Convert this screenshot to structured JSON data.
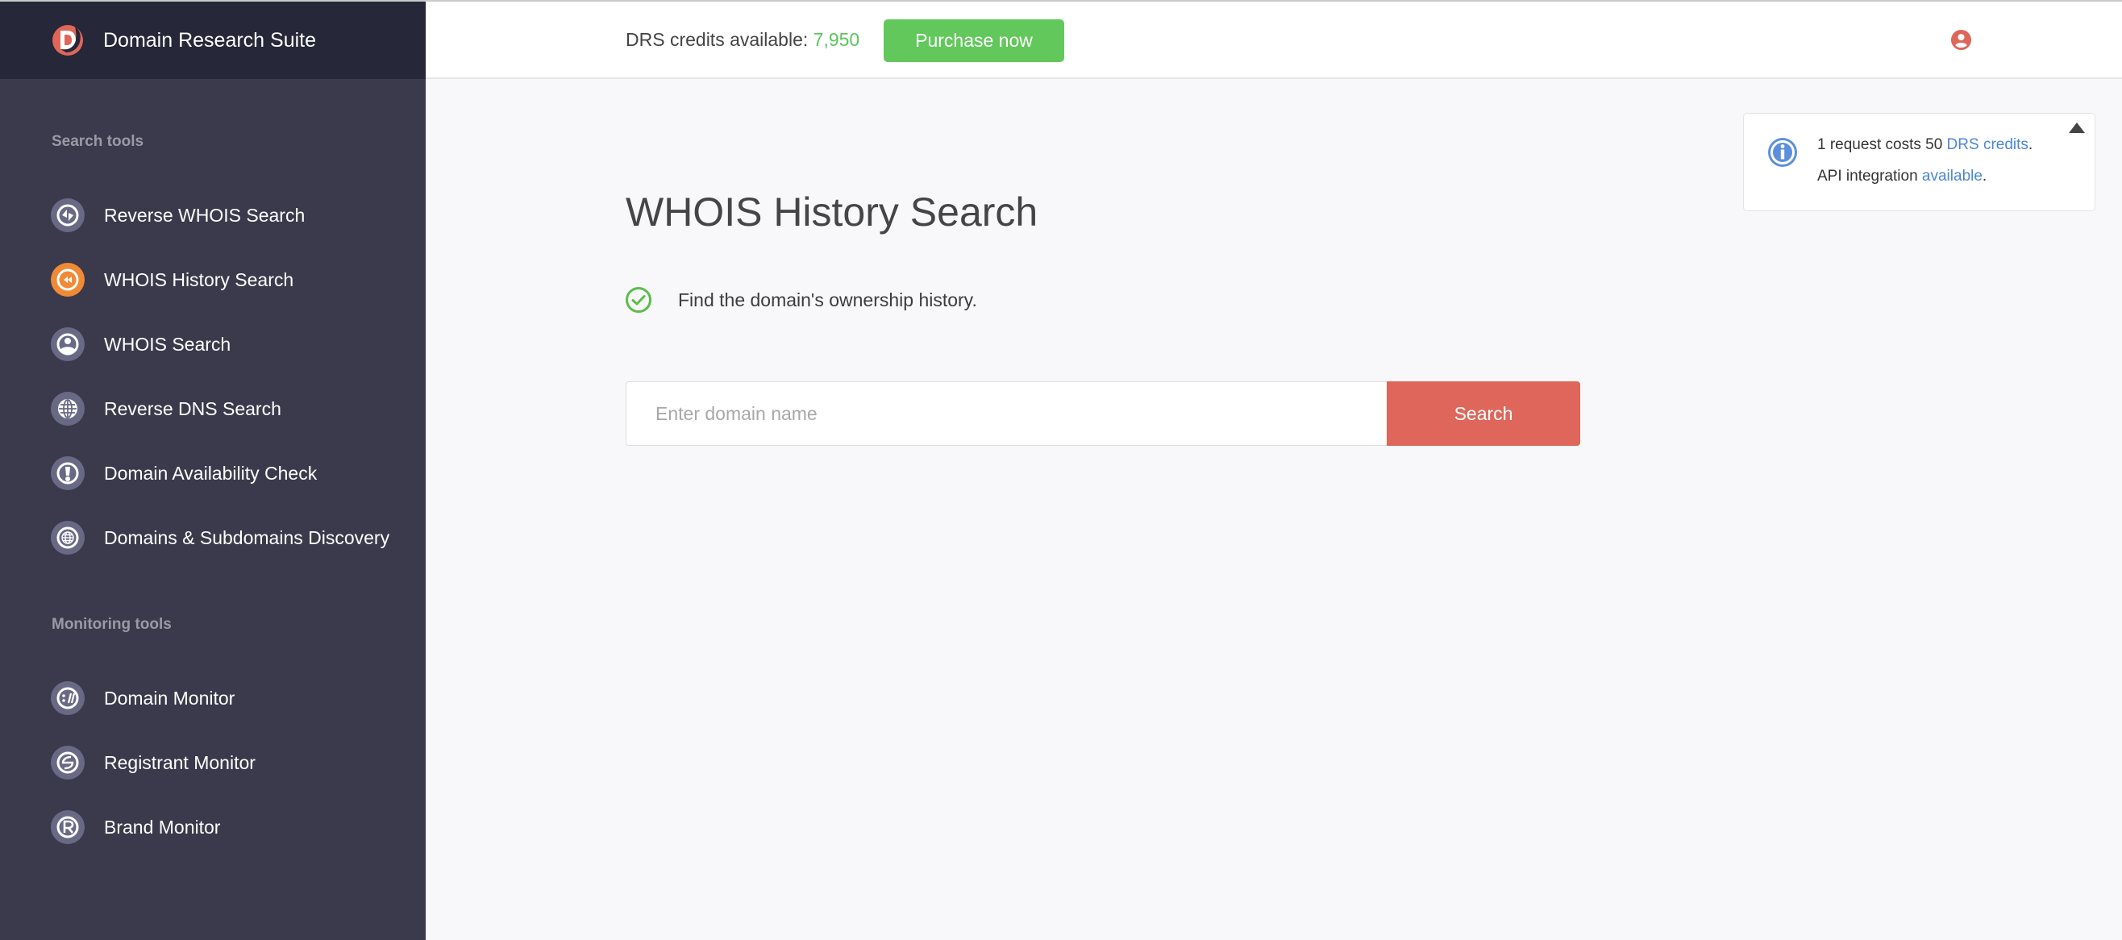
{
  "app": {
    "name": "Domain Research Suite",
    "logo_icon": "drs-logo-icon"
  },
  "sidebar": {
    "sections": [
      {
        "label": "Search tools",
        "items": [
          {
            "label": "Reverse WHOIS Search",
            "icon": "reverse-whois-icon",
            "active": false
          },
          {
            "label": "WHOIS History Search",
            "icon": "history-rewind-icon",
            "active": true
          },
          {
            "label": "WHOIS Search",
            "icon": "user-profile-icon",
            "active": false
          },
          {
            "label": "Reverse DNS Search",
            "icon": "globe-icon",
            "active": false
          },
          {
            "label": "Domain Availability Check",
            "icon": "exclamation-icon",
            "active": false
          },
          {
            "label": "Domains & Subdomains Discovery",
            "icon": "globe-ring-icon",
            "active": false
          }
        ]
      },
      {
        "label": "Monitoring tools",
        "items": [
          {
            "label": "Domain Monitor",
            "icon": "url-slashes-icon",
            "active": false
          },
          {
            "label": "Registrant Monitor",
            "icon": "registrant-icon",
            "active": false
          },
          {
            "label": "Brand Monitor",
            "icon": "registered-trademark-icon",
            "active": false
          }
        ]
      }
    ]
  },
  "topbar": {
    "credits_label": "DRS credits available: ",
    "credits_value": "7,950",
    "purchase_label": "Purchase now",
    "user_icon": "user-account-icon"
  },
  "main": {
    "title": "WHOIS History Search",
    "feature_text": "Find the domain's ownership history.",
    "search": {
      "placeholder": "Enter domain name",
      "value": "",
      "button_label": "Search"
    }
  },
  "info_panel": {
    "line1_prefix": "1 request costs 50 ",
    "line1_link": "DRS credits",
    "line1_suffix": ".",
    "line2_prefix": "API integration ",
    "line2_link": "available",
    "line2_suffix": "."
  },
  "colors": {
    "sidebar_bg": "#3a3a4c",
    "sidebar_header_bg": "#262738",
    "active_icon": "#f08a35",
    "accent_red": "#de665b",
    "accent_green": "#62c85c",
    "link_blue": "#4a86d8"
  }
}
